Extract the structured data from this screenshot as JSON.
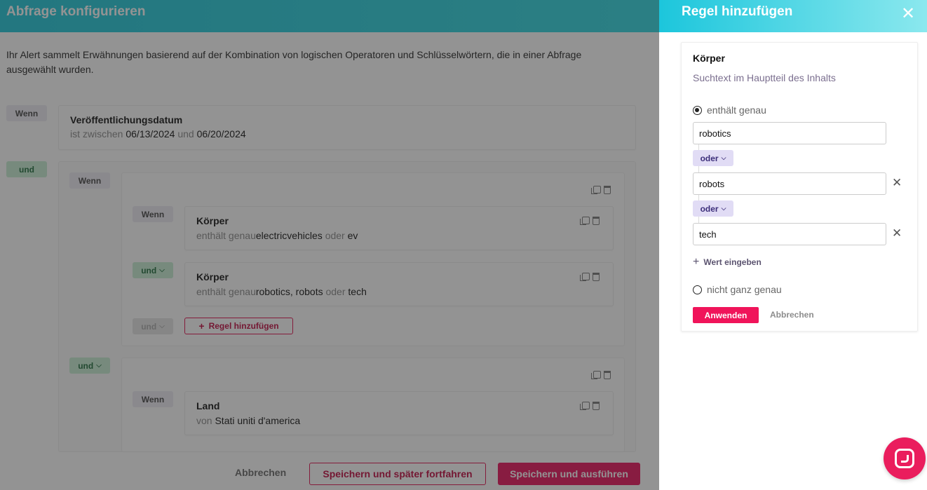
{
  "main": {
    "title": "Abfrage konfigurieren",
    "intro": "Ihr Alert sammelt Erwähnungen basierend auf der Kombination von logischen Operatoren und Schlüsselwörtern, die in einer Abfrage ausgewählt wurden.",
    "wenn": "Wenn",
    "und": "und",
    "date_rule": {
      "title": "Veröffentlichungsdatum",
      "prefix": "ist zwischen",
      "from": "06/13/2024",
      "joiner": "und",
      "to": "06/20/2024"
    },
    "rule1": {
      "title": "Körper",
      "prefix": "enthält genau",
      "v1": "electricvehicles",
      "joiner": "oder",
      "v2": "ev"
    },
    "rule2": {
      "title": "Körper",
      "prefix": "enthält genau",
      "v1": "robotics,",
      "v2": "robots",
      "joiner": "oder",
      "v3": "tech"
    },
    "add_rule": "Regel hinzufügen",
    "rule3": {
      "title": "Land",
      "prefix": "von",
      "v1": "Stati uniti d'america"
    },
    "footer": {
      "cancel": "Abbrechen",
      "save_later": "Speichern und später fortfahren",
      "save_run": "Speichern und ausführen"
    }
  },
  "drawer": {
    "title": "Regel hinzufügen",
    "rule_title": "Körper",
    "rule_subtitle": "Suchtext im Hauptteil des Inhalts",
    "option_exact": "enthält genau",
    "option_loose": "nicht ganz genau",
    "values": [
      "robotics",
      "robots",
      "tech"
    ],
    "or_label": "oder",
    "add_value": "Wert eingeben",
    "apply": "Anwenden",
    "cancel": "Abbrechen"
  },
  "colors": {
    "accent": "#e8115b",
    "header": "#1ec6d8",
    "and_tag": "#c6ecd2",
    "or_tag": "#e1dcf5"
  }
}
